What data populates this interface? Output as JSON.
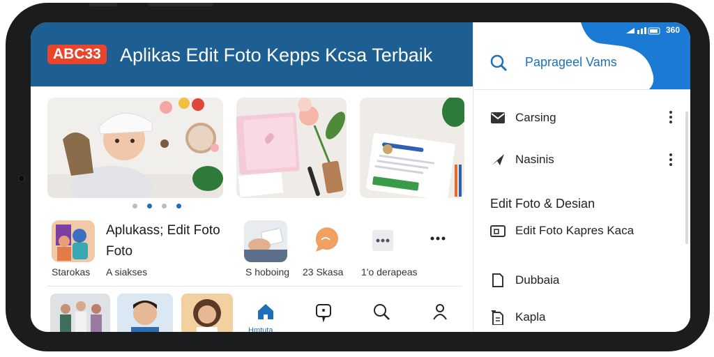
{
  "header": {
    "logo": "ABC33",
    "title": "Aplikas Edit Foto Kepps Kcsa Terbaik"
  },
  "carousel": {
    "images": [
      "baby-with-plush-photo",
      "pink-notebook-flowers-photo",
      "document-card-photo"
    ],
    "dots": 4,
    "active_dot": 2
  },
  "apps": {
    "featured_name": "Aplukass; Edit Foto Foto",
    "featured_label": "Starokas",
    "featured_sub": "A siakses",
    "items": [
      {
        "label": "S hoboing"
      },
      {
        "label": "23 Skasa"
      },
      {
        "label": "1'o derapeas"
      }
    ]
  },
  "bottom_nav": {
    "home_label": "Hmtuta",
    "icons": [
      "home-icon",
      "chat-icon",
      "search-icon",
      "profile-icon"
    ]
  },
  "drawer": {
    "status_text": "360",
    "search_placeholder": "Paprageel Vams",
    "items": [
      {
        "label": "Carsing",
        "icon": "mail-icon"
      },
      {
        "label": "Nasinis",
        "icon": "send-icon"
      }
    ],
    "section_title": "Edit Foto & Desian",
    "section_items": [
      {
        "label": "Edit Foto Kapres Kaca",
        "icon": "folder-icon"
      },
      {
        "label": "Dubbaia",
        "icon": "file-icon"
      },
      {
        "label": "Kapla",
        "icon": "document-icon"
      }
    ]
  },
  "colors": {
    "header": "#1e5f93",
    "accent": "#1e6fb8",
    "logo": "#e8452c",
    "drawer_accent": "#1a7ad4"
  }
}
